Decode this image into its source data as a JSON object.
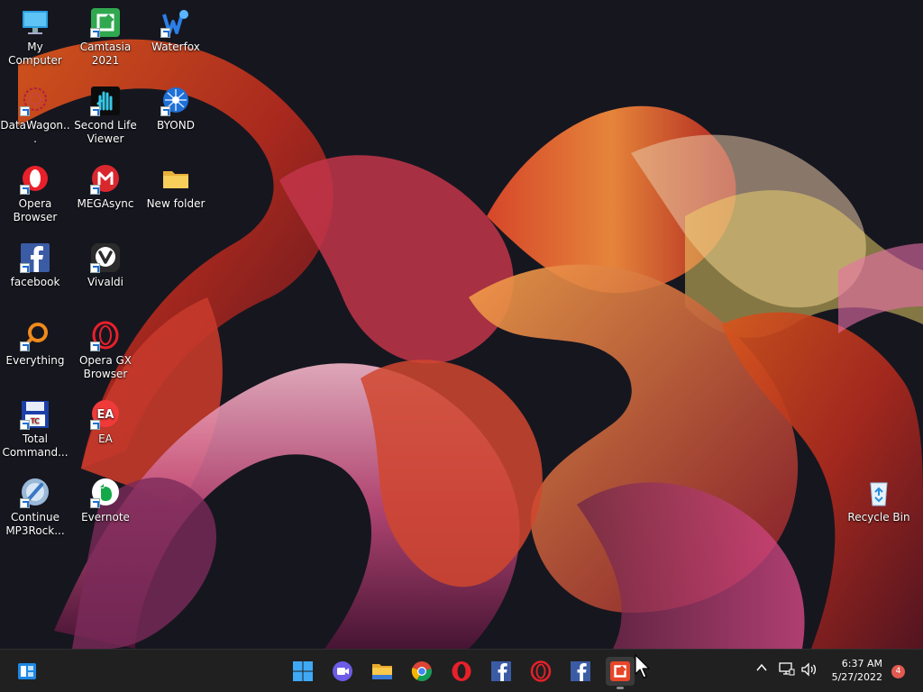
{
  "desktop": {
    "icons": [
      {
        "label": "My Computer",
        "icon": "monitor-icon"
      },
      {
        "label": "Camtasia 2021",
        "icon": "camtasia-icon"
      },
      {
        "label": "Waterfox",
        "icon": "waterfox-icon"
      },
      {
        "label": "DataWagon...",
        "icon": "datawagon-icon"
      },
      {
        "label": "Second Life Viewer",
        "icon": "second-life-icon"
      },
      {
        "label": "BYOND",
        "icon": "byond-icon"
      },
      {
        "label": "Opera Browser",
        "icon": "opera-icon"
      },
      {
        "label": "MEGAsync",
        "icon": "mega-icon"
      },
      {
        "label": "New folder",
        "icon": "folder-icon"
      },
      {
        "label": "facebook",
        "icon": "facebook-icon"
      },
      {
        "label": "Vivaldi",
        "icon": "vivaldi-icon"
      },
      {
        "label": "Everything",
        "icon": "everything-icon"
      },
      {
        "label": "Opera GX Browser",
        "icon": "opera-gx-icon"
      },
      {
        "label": "Total Command...",
        "icon": "total-commander-icon"
      },
      {
        "label": "EA",
        "icon": "ea-icon"
      },
      {
        "label": "Continue MP3Rock...",
        "icon": "mp3rocket-icon"
      },
      {
        "label": "Evernote",
        "icon": "evernote-icon"
      },
      {
        "label": "Recycle Bin",
        "icon": "recycle-bin-icon"
      }
    ]
  },
  "taskbar": {
    "apps": [
      {
        "name": "Windows Start",
        "icon": "windows-start-icon"
      },
      {
        "name": "Meet",
        "icon": "video-chat-icon"
      },
      {
        "name": "File Explorer",
        "icon": "folder-icon"
      },
      {
        "name": "Google Chrome",
        "icon": "chrome-icon"
      },
      {
        "name": "Opera",
        "icon": "opera-icon"
      },
      {
        "name": "facebook",
        "icon": "facebook-icon"
      },
      {
        "name": "Opera GX",
        "icon": "opera-gx-icon"
      },
      {
        "name": "facebook",
        "icon": "facebook-icon"
      },
      {
        "name": "Camtasia",
        "icon": "camtasia-icon",
        "active": true
      }
    ],
    "widgets_icon": "widgets-icon",
    "tray": {
      "chevron": "^",
      "network_icon": "network-icon",
      "volume_icon": "volume-icon"
    },
    "clock": {
      "time": "6:37 AM",
      "date": "5/27/2022"
    },
    "notification_count": "4"
  },
  "colors": {
    "taskbar_bg": "#202020",
    "accent_blue": "#1d6fd8",
    "notification_badge": "#e05a50"
  }
}
